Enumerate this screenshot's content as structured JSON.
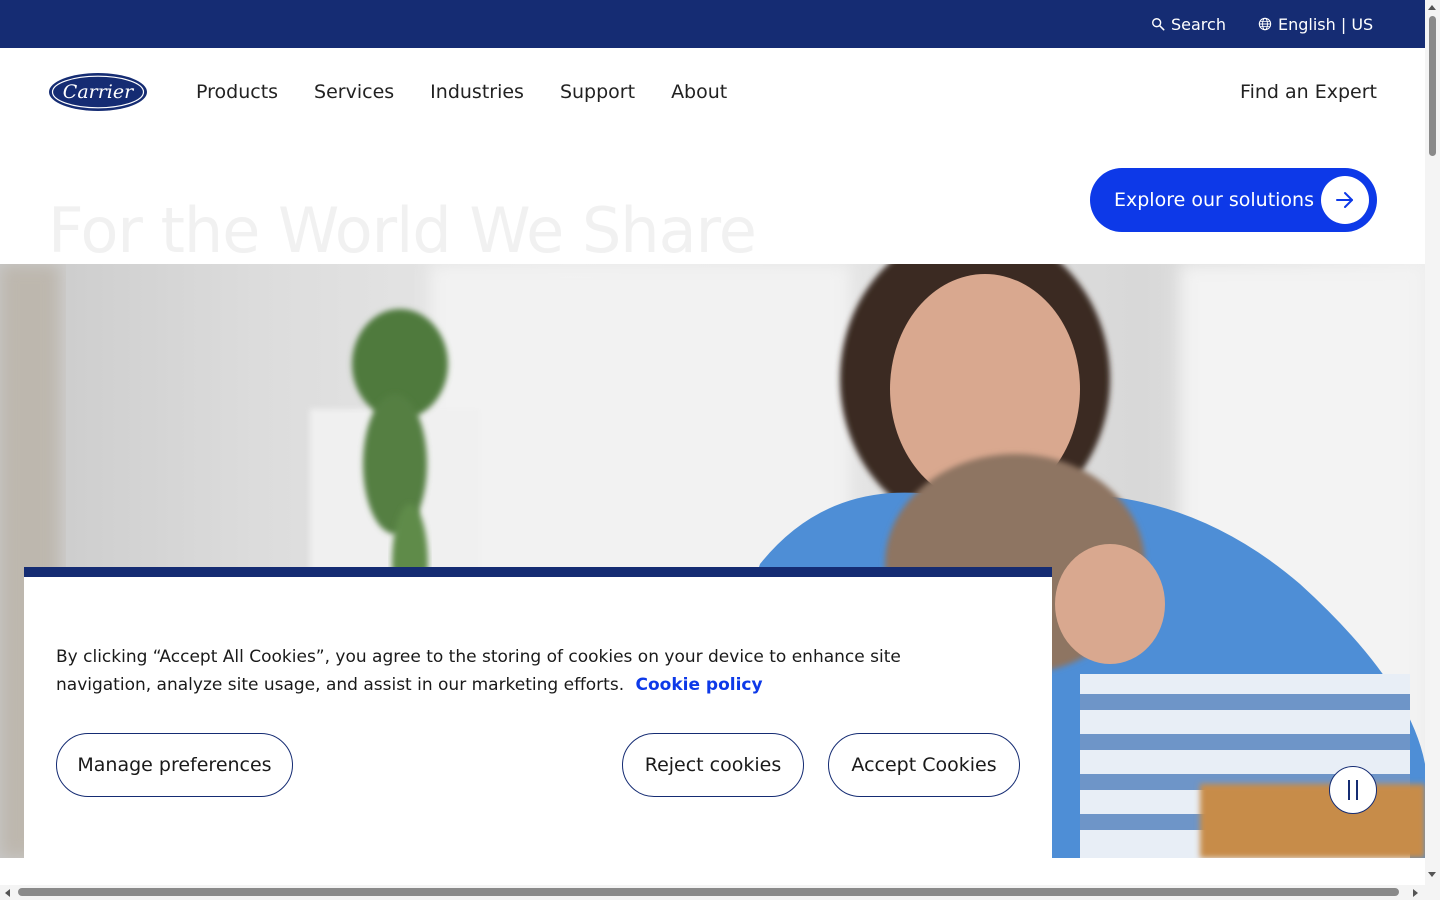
{
  "utility_bar": {
    "search_label": "Search",
    "language_label": "English | US",
    "background_color": "#152c73"
  },
  "logo": {
    "text": "Carrier",
    "icon": "carrier-logo"
  },
  "nav": {
    "items": [
      {
        "label": "Products"
      },
      {
        "label": "Services"
      },
      {
        "label": "Industries"
      },
      {
        "label": "Support"
      },
      {
        "label": "About"
      }
    ],
    "find_expert_label": "Find an Expert"
  },
  "hero": {
    "title": "For the World We Share",
    "cta_label": "Explore our solutions",
    "cta_color": "#0d39e8",
    "pause_icon": "pause-icon"
  },
  "cookie_banner": {
    "message": "By clicking “Accept All Cookies”, you agree to the storing of cookies on your device to enhance site navigation, analyze site usage, and assist in our marketing efforts.",
    "policy_link": "Cookie policy",
    "manage_label": "Manage preferences",
    "reject_label": "Reject cookies",
    "accept_label": "Accept Cookies",
    "accent_color": "#152c73"
  }
}
